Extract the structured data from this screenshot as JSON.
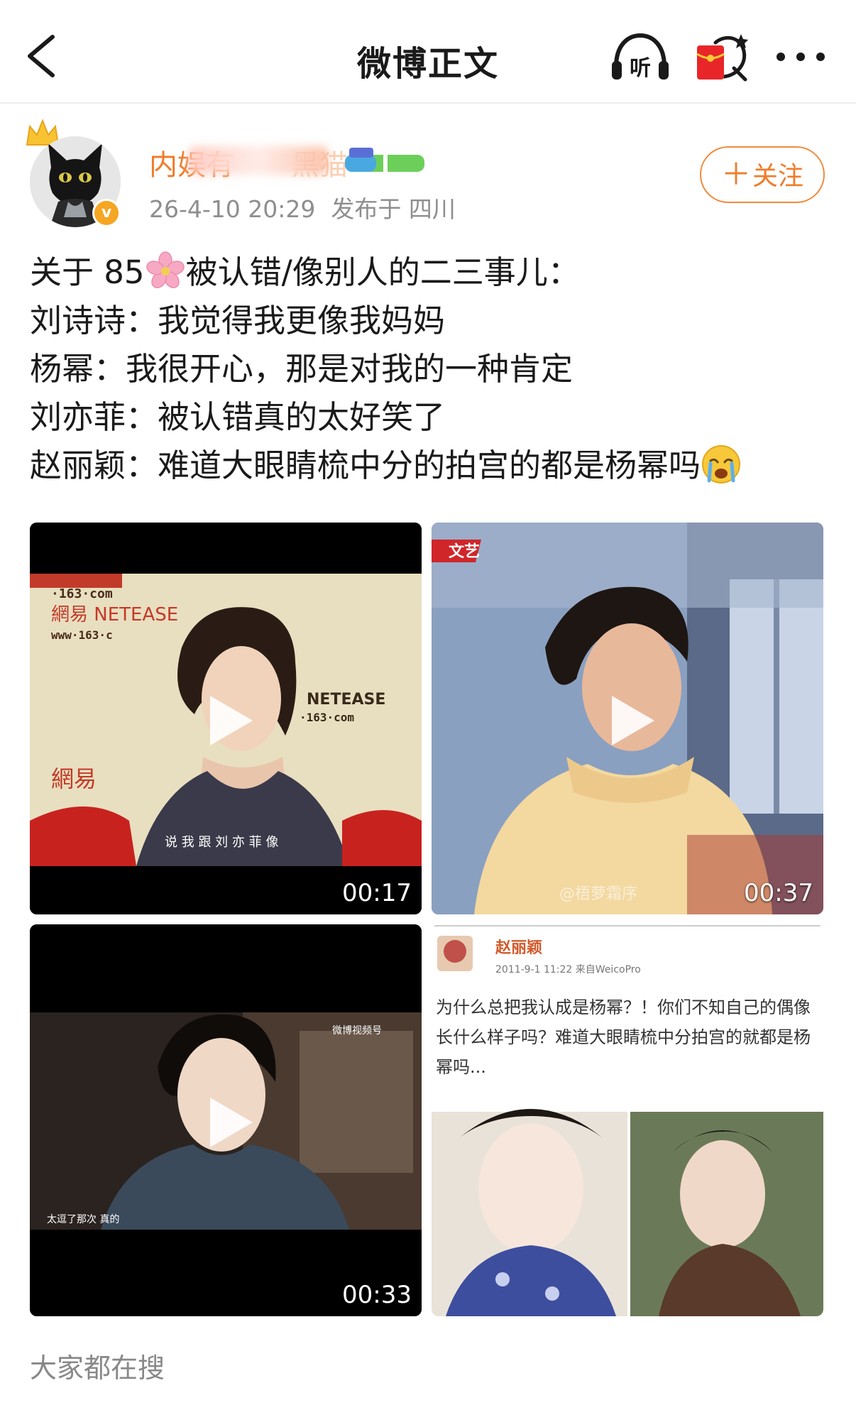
{
  "nav": {
    "back_icon": "chevron-left-icon",
    "title": "微博正文",
    "listen_label": "听",
    "red_packet_icon": "red-packet-icon",
    "more_icon": "more-icon"
  },
  "author": {
    "name_visible": "内娱有",
    "name_tail": "黑猫",
    "time": "26-4-10 20:29",
    "location": "发布于 四川",
    "verified_badge": "v",
    "follow_label": "关注",
    "follow_plus": "＋",
    "accent_color": "#f07c2a"
  },
  "post": {
    "lines": [
      {
        "text": "关于 85",
        "after": "被认错/像别人的二三事儿："
      },
      {
        "text": "刘诗诗：我觉得我更像我妈妈"
      },
      {
        "text": "杨幂：我很开心，那是对我的一种肯定"
      },
      {
        "text": "刘亦菲：被认错真的太好笑了"
      },
      {
        "text": "赵丽颖：难道大眼睛梳中分的拍宫的都是杨幂吗"
      }
    ]
  },
  "media": [
    {
      "duration": "00:17",
      "logo1": "·163·com",
      "logo2": "網易 NETEASE",
      "logo3": "www·163·c",
      "logo4": "NETEASE",
      "logo5": "·163·com",
      "logo6": "網易",
      "subtitle": "说 我 跟 刘 亦 菲 像"
    },
    {
      "duration": "00:37",
      "channel": "文艺",
      "watermark": "@梧萝霜序"
    },
    {
      "duration": "00:33",
      "watermark": "微博视频号",
      "subtitle": "太逗了那次 真的"
    },
    {
      "user": "赵丽颖",
      "meta": "2011-9-1 11:22  来自WeicoPro",
      "text": "为什么总把我认成是杨幂？！你们不知自己的偶像长什么样子吗？难道大眼睛梳中分拍宫的就都是杨幂吗..."
    }
  ],
  "section": {
    "title": "大家都在搜"
  }
}
